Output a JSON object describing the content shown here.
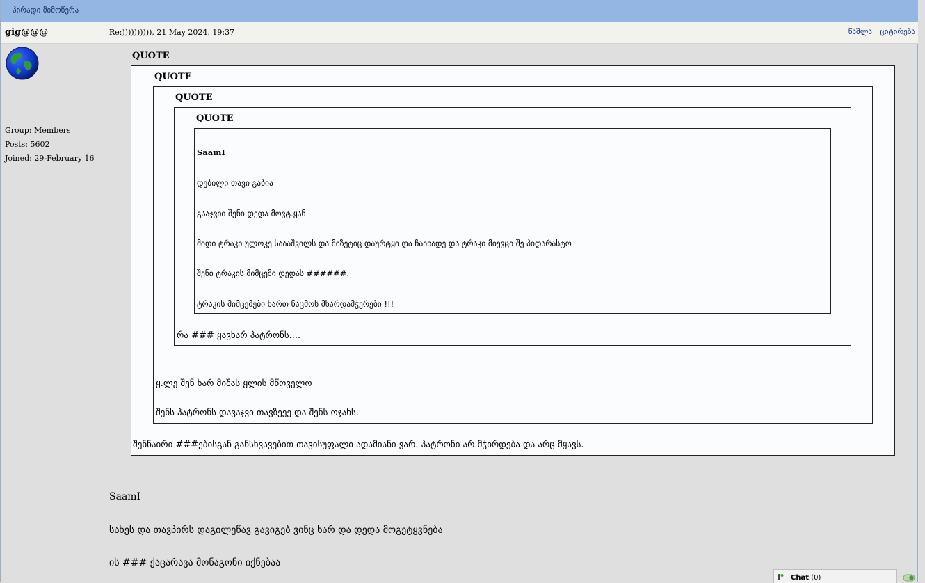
{
  "page_title": "პირადი მიმოწერა",
  "post": {
    "username": "gig@@@",
    "meta": "Re:)))))))))), 21 May 2024, 19:37",
    "actions": {
      "delete": "წაშლა",
      "quote": "ციტირება"
    },
    "user_info": {
      "group": "Group: Members",
      "posts": "Posts: 5602",
      "joined": "Joined: 29-February 16"
    }
  },
  "quotes": {
    "label": "QUOTE",
    "inner": {
      "author": "SaamI",
      "lines": [
        "დებილი თავი გაბია",
        "გააჯვიი შენი დედა მოვტ.ყან",
        "მიდი ტრაკი ულოკე საააშვილს და მიზეტიც დაურტყი  და ჩაიხადე და ტრაკი მიევცი შე პიდარასტო",
        "შენი ტრაკის მიმცემი დედას ######.",
        "ტრაკის მიმცემები ხართ ნაცმოს მხარდამჭერები !!!"
      ]
    },
    "level3_line": "რა ### ყავხარ პატრონს....",
    "level2_lines": [
      "ყ.ლე შენ ხარ მიშას ყლის მწოველო",
      "შენს პატრონს დავაჯვი თავზეეე და შენს ოჯახს."
    ],
    "level1_line": "შენნაირი ###ებისგან განსხვავებით თავისუფალი ადამიანი ვარ. პატრონი არ მჭირდება და არც მყავს."
  },
  "body": {
    "author": "SaamI",
    "lines": [
      "სახეს და თავპირს დაგილეწავ გავიგებ ვინც ხარ და დედა მოგეტყვნება",
      "ის ### ქაცარავა მონაგონი იქნებაა"
    ]
  },
  "chat": {
    "label": "Chat",
    "count": "(0)"
  }
}
